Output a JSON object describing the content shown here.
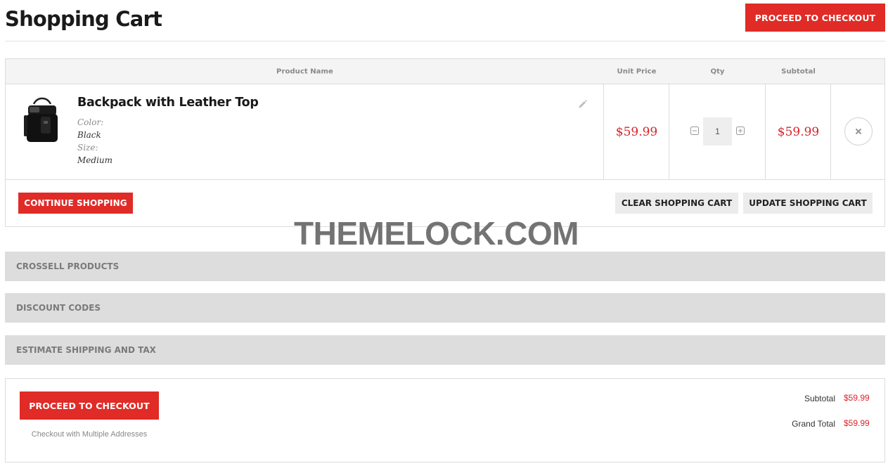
{
  "page": {
    "title": "Shopping Cart",
    "watermark": "THEMELOCK.COM"
  },
  "header": {
    "checkout_label": "PROCEED TO CHECKOUT"
  },
  "table": {
    "columns": [
      "Product Name",
      "Unit Price",
      "Qty",
      "Subtotal"
    ],
    "items": [
      {
        "name": "Backpack with Leather Top",
        "options": [
          {
            "label": "Color:",
            "value": "Black"
          },
          {
            "label": "Size:",
            "value": "Medium"
          }
        ],
        "unit_price": "$59.99",
        "qty": "1",
        "subtotal": "$59.99",
        "icons": {
          "edit": "pencil-icon",
          "minus": "minus-box-icon",
          "plus": "plus-box-icon",
          "remove": "close-icon"
        }
      }
    ]
  },
  "actions": {
    "continue_label": "CONTINUE SHOPPING",
    "clear_label": "CLEAR SHOPPING CART",
    "update_label": "UPDATE SHOPPING CART"
  },
  "sections": [
    "CROSSELL PRODUCTS",
    "DISCOUNT CODES",
    "ESTIMATE SHIPPING AND TAX"
  ],
  "totals": {
    "checkout_label": "PROCEED TO CHECKOUT",
    "multi_address_label": "Checkout with Multiple Addresses",
    "subtotal_label": "Subtotal",
    "subtotal_value": "$59.99",
    "grand_total_label": "Grand Total",
    "grand_total_value": "$59.99"
  },
  "colors": {
    "accent": "#e02b27",
    "price": "#d9242b",
    "section_bg": "#dddddd",
    "header_bg": "#f4f4f4"
  }
}
